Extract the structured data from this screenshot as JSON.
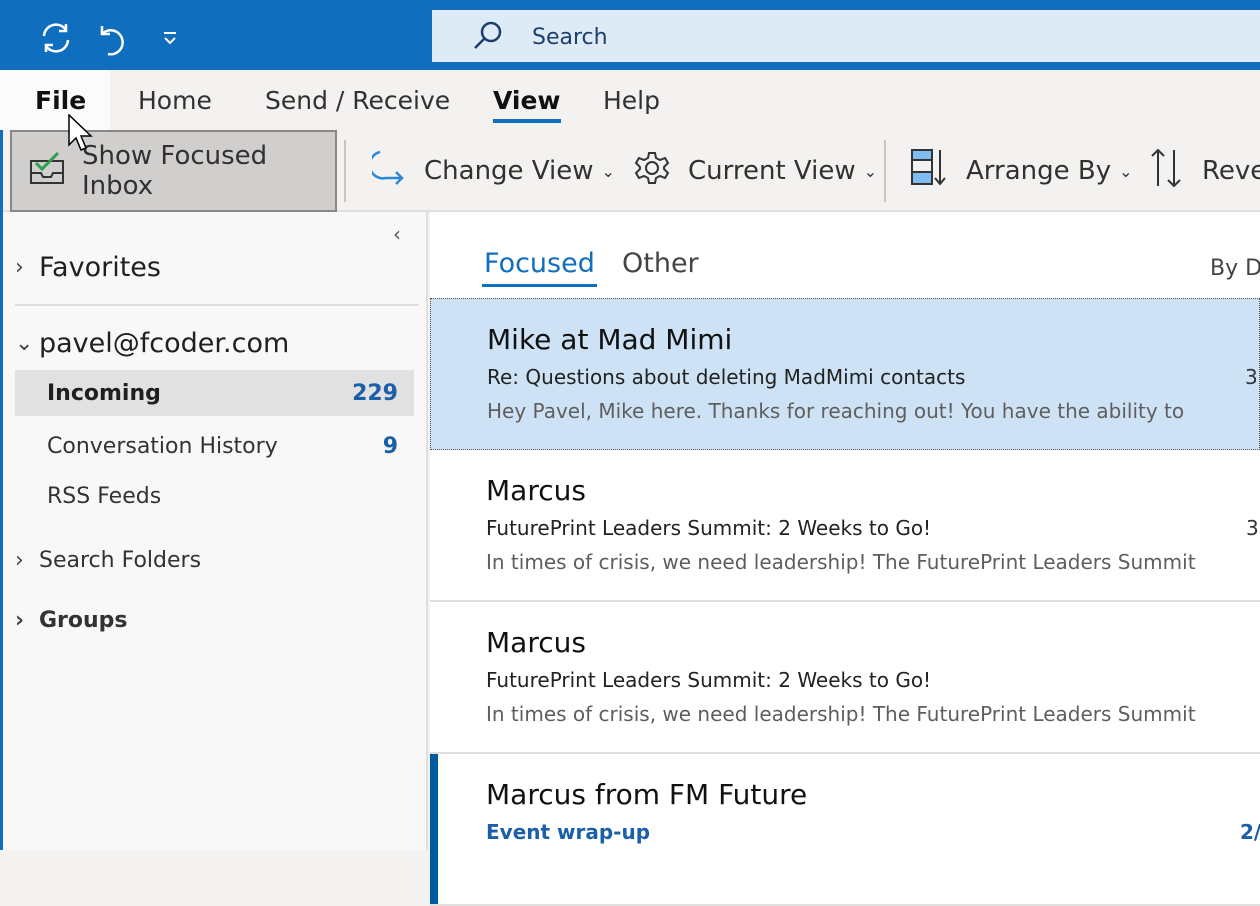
{
  "quick_access": {
    "icons": [
      "sync-icon",
      "undo-icon",
      "customize-toolbar-icon"
    ]
  },
  "search": {
    "placeholder": "Search"
  },
  "menu": {
    "file": "File",
    "home": "Home",
    "send_receive": "Send / Receive",
    "view": "View",
    "help": "Help"
  },
  "ribbon": {
    "show_focused_inbox": "Show Focused Inbox",
    "change_view": "Change View",
    "current_view": "Current View",
    "arrange_by": "Arrange By",
    "reverse_sort": "Reve"
  },
  "nav": {
    "favorites": "Favorites",
    "account": "pavel@fcoder.com",
    "folders": [
      {
        "label": "Incoming",
        "count": "229"
      },
      {
        "label": "Conversation History",
        "count": "9"
      },
      {
        "label": "RSS Feeds",
        "count": ""
      }
    ],
    "search_folders": "Search Folders",
    "groups": "Groups"
  },
  "list": {
    "tabs": {
      "focused": "Focused",
      "other": "Other"
    },
    "sort_label": "By D",
    "messages": [
      {
        "from": "Mike at Mad Mimi",
        "subject": "Re: Questions about deleting MadMimi contacts",
        "preview": "Hey Pavel,  Mike here. Thanks for reaching out!  You have the ability to",
        "date": "3",
        "selected": true,
        "unread": false
      },
      {
        "from": "Marcus",
        "subject": "FuturePrint Leaders Summit: 2 Weeks to Go!",
        "preview": "In times of crisis, we need leadership! The FuturePrint Leaders Summit",
        "date": "3",
        "selected": false,
        "unread": false
      },
      {
        "from": "Marcus",
        "subject": "FuturePrint Leaders Summit: 2 Weeks to Go!",
        "preview": "In times of crisis, we need leadership! The FuturePrint Leaders Summit",
        "date": "",
        "selected": false,
        "unread": false
      },
      {
        "from": "Marcus from FM Future",
        "subject": "Event wrap-up",
        "preview": "",
        "date": "2/",
        "selected": false,
        "unread": true
      }
    ]
  }
}
